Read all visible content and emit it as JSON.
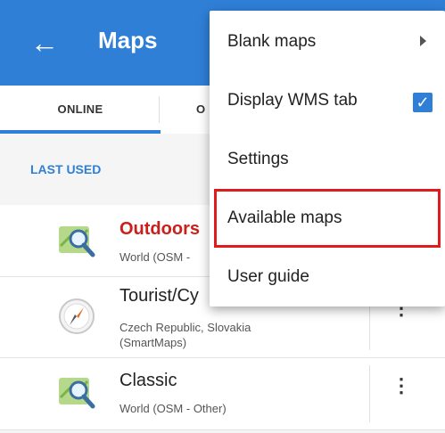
{
  "header": {
    "title": "Maps",
    "back_icon": "arrow-left-icon"
  },
  "tabs": [
    {
      "label": "ONLINE",
      "active": true
    },
    {
      "label": "O"
    }
  ],
  "section": {
    "label": "LAST USED"
  },
  "maps": [
    {
      "name": "Outdoors",
      "subtitle": "World (OSM -",
      "icon": "map-magnifier-icon",
      "name_color": "#c9201b"
    },
    {
      "name": "Tourist/Cy",
      "subtitle": "Czech Republic, Slovakia\n(SmartMaps)",
      "icon": "compass-icon"
    },
    {
      "name": "Classic",
      "subtitle": "World (OSM - Other)",
      "icon": "map-magnifier-icon"
    }
  ],
  "menu": {
    "items": [
      {
        "label": "Blank maps",
        "type": "submenu"
      },
      {
        "label": "Display WMS tab",
        "type": "checkbox",
        "checked": true
      },
      {
        "label": "Settings"
      },
      {
        "label": "Available maps",
        "highlighted": true
      },
      {
        "label": "User guide"
      }
    ]
  },
  "colors": {
    "accent": "#2f7fd6",
    "highlight_border": "#e11b1b",
    "outdoors_red": "#c9201b"
  }
}
